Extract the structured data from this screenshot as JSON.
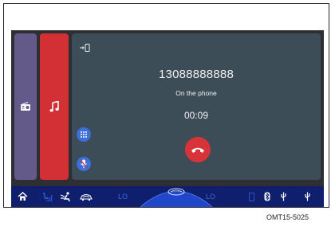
{
  "call": {
    "number": "13088888888",
    "status": "On the phone",
    "duration": "00:09"
  },
  "sources": {
    "radio_icon": "radio-icon",
    "music_icon": "music-note-icon"
  },
  "climate": {
    "left_temp": "LO",
    "right_temp": "LO"
  },
  "caption": "OMT15-5025",
  "colors": {
    "radio_tab": "#635a8a",
    "music_tab": "#d23034",
    "call_panel": "#3c4d58",
    "hangup": "#d73338",
    "bottom_bar": "#0f1f6e",
    "accent_blue": "#3d6fd9"
  }
}
